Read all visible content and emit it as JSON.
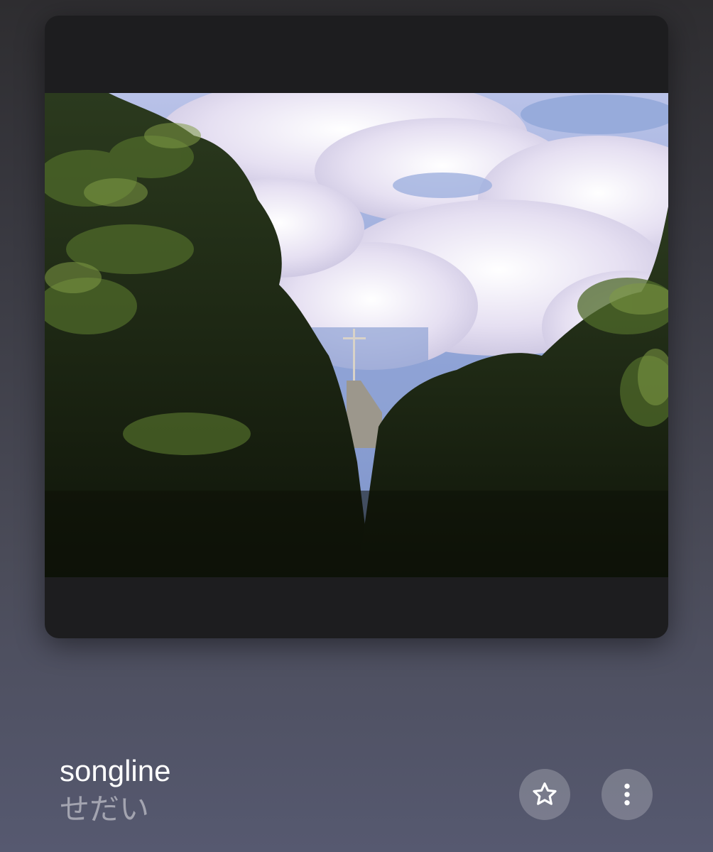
{
  "now_playing": {
    "title": "songline",
    "artist": "せだい"
  },
  "artwork": {
    "description_icon": "album-artwork",
    "colors": {
      "sky": "#8fa3d6",
      "clouds": "#e6e0f2",
      "foliage_dark": "#1b2414",
      "foliage_light": "#6f8a3a",
      "letterbox": "#1d1d1f"
    }
  },
  "controls": {
    "favorite_icon": "star-icon",
    "more_icon": "more-vertical-icon"
  }
}
